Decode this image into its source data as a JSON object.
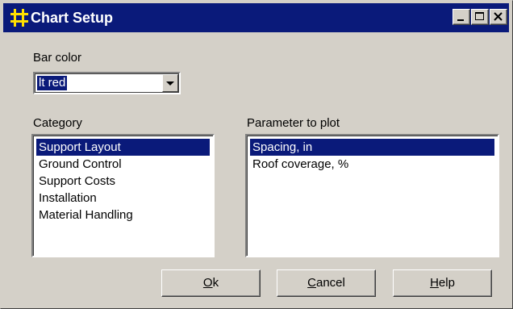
{
  "window": {
    "title": "Chart Setup"
  },
  "bar_color": {
    "label": "Bar color",
    "selected": "lt red"
  },
  "category": {
    "label": "Category",
    "items": [
      "Support Layout",
      "Ground Control",
      "Support Costs",
      "Installation",
      "Material Handling"
    ],
    "selected_index": 0
  },
  "parameter": {
    "label": "Parameter to plot",
    "items": [
      "Spacing, in",
      "Roof coverage, %"
    ],
    "selected_index": 0
  },
  "buttons": {
    "ok": {
      "mnemonic": "O",
      "rest": "k"
    },
    "cancel": {
      "mnemonic": "C",
      "rest": "ancel"
    },
    "help": {
      "mnemonic": "H",
      "rest": "elp"
    }
  },
  "colors": {
    "titlebar": "#0a1a7a",
    "selection": "#0a1a7a",
    "face": "#d4d0c8",
    "icon": "#ffe000"
  }
}
